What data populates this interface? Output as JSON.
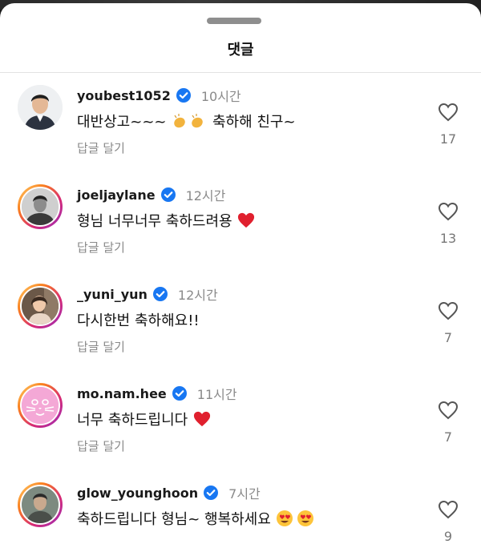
{
  "sheet": {
    "title": "댓글"
  },
  "reply_label": "답글 달기",
  "comments": [
    {
      "username": "youbest1052",
      "time": "10시간",
      "text": "대반상고~~~",
      "text_after": "축하해 친구~",
      "likes": "17"
    },
    {
      "username": "joeljaylane",
      "time": "12시간",
      "text": "형님 너무너무 축하드려용",
      "likes": "13"
    },
    {
      "username": "_yuni_yun",
      "time": "12시간",
      "text": "다시한번 축하해요!!",
      "likes": "7"
    },
    {
      "username": "mo.nam.hee",
      "time": "11시간",
      "text": "너무 축하드립니다",
      "likes": "7"
    },
    {
      "username": "glow_younghoon",
      "time": "7시간",
      "text": "축하드립니다 형님~ 행복하세요",
      "likes": "9"
    }
  ],
  "colors": {
    "verified": "#1877f2",
    "heart_emoji": "#e0202e",
    "ring_start": "#feda75",
    "ring_end": "#962fbf"
  },
  "icons": [
    "verified-badge-icon",
    "heart-outline-icon",
    "clapping-hands-emoji",
    "red-heart-emoji",
    "heart-eyes-emoji"
  ]
}
